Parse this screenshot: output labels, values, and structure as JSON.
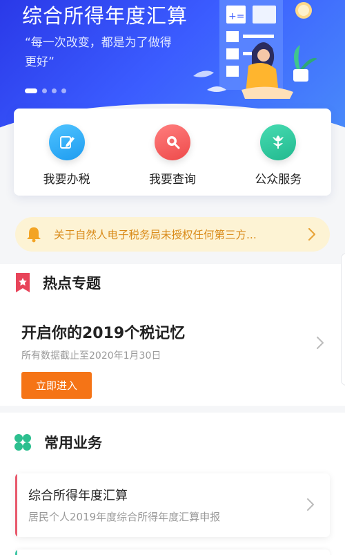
{
  "banner": {
    "title": "综合所得年度汇算",
    "quote": "“每一次改变，都是为了做得更好”",
    "slides": [
      true,
      false,
      false,
      false
    ]
  },
  "services": [
    {
      "label": "我要办税",
      "icon": "pen-icon",
      "color": "#29aef5"
    },
    {
      "label": "我要查询",
      "icon": "magnifier-icon",
      "color": "#f25a5a"
    },
    {
      "label": "公众服务",
      "icon": "tulip-icon",
      "color": "#2dcba0"
    }
  ],
  "notice": {
    "text": "关于自然人电子税务局未授权任何第三方...",
    "icon": "bell-icon",
    "color": "#f3a425"
  },
  "hot_topic": {
    "section_title": "热点专题",
    "title": "开启你的2019个税记忆",
    "subtitle": "所有数据截止至2020年1月30日",
    "button": "立即进入",
    "accent": "#e8445a"
  },
  "common_business": {
    "section_title": "常用业务",
    "accent": "#2dbf8f",
    "items": [
      {
        "title": "综合所得年度汇算",
        "subtitle": "居民个人2019年度综合所得年度汇算申报"
      }
    ]
  }
}
